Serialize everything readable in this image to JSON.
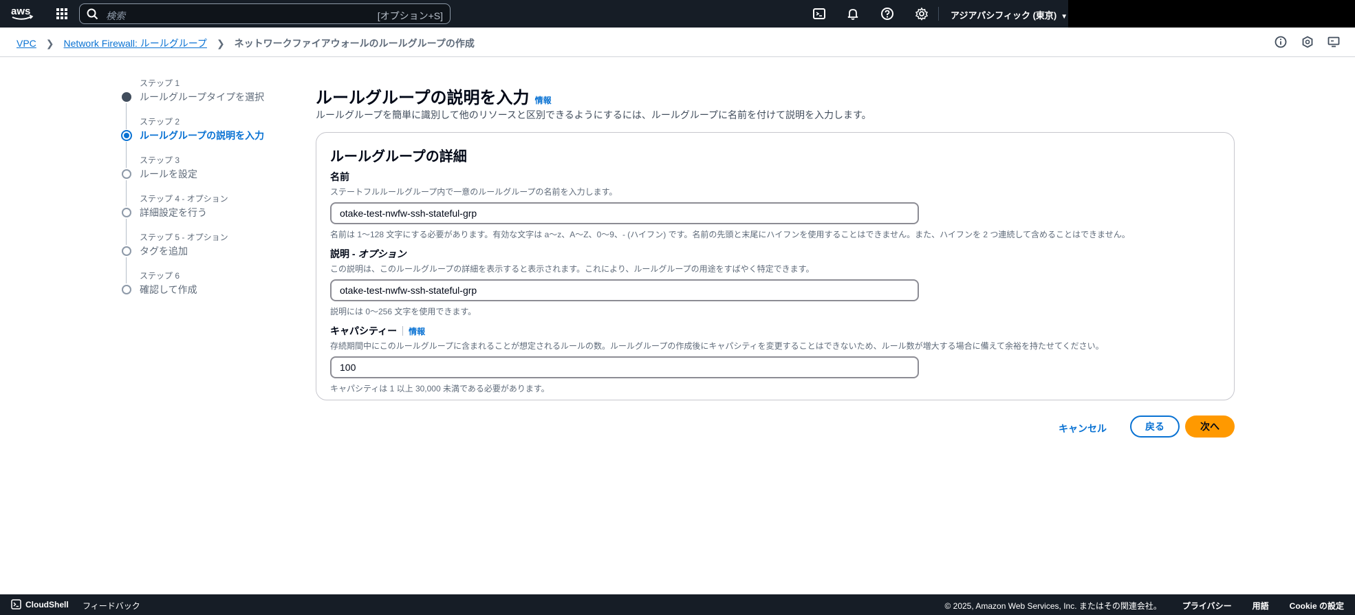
{
  "nav": {
    "search_placeholder": "検索",
    "search_shortcut": "[オプション+S]",
    "region": "アジアパシフィック (東京)"
  },
  "breadcrumb": {
    "items": [
      "VPC",
      "Network Firewall: ルールグループ"
    ],
    "current": "ネットワークファイアウォールのルールグループの作成"
  },
  "steps": [
    {
      "num": "ステップ 1",
      "title": "ルールグループタイプを選択"
    },
    {
      "num": "ステップ 2",
      "title": "ルールグループの説明を入力"
    },
    {
      "num": "ステップ 3",
      "title": "ルールを設定"
    },
    {
      "num": "ステップ 4 - オプション",
      "title": "詳細設定を行う"
    },
    {
      "num": "ステップ 5 - オプション",
      "title": "タグを追加"
    },
    {
      "num": "ステップ 6",
      "title": "確認して作成"
    }
  ],
  "main": {
    "title": "ルールグループの説明を入力",
    "info": "情報",
    "description": "ルールグループを簡単に識別して他のリソースと区別できるようにするには、ルールグループに名前を付けて説明を入力します。"
  },
  "panel": {
    "title": "ルールグループの詳細",
    "name": {
      "label": "名前",
      "desc": "ステートフルルールグループ内で一意のルールグループの名前を入力します。",
      "value": "otake-test-nwfw-ssh-stateful-grp",
      "constraint": "名前は 1～128 文字にする必要があります。有効な文字は a～z、A～Z、0～9、- (ハイフン) です。名前の先頭と末尾にハイフンを使用することはできません。また、ハイフンを 2 つ連続して含めることはできません。"
    },
    "description": {
      "label": "説明 - ",
      "label_optional": "オプション",
      "desc": "この説明は、このルールグループの詳細を表示すると表示されます。これにより、ルールグループの用途をすばやく特定できます。",
      "value": "otake-test-nwfw-ssh-stateful-grp",
      "constraint": "説明には 0～256 文字を使用できます。"
    },
    "capacity": {
      "label": "キャパシティー",
      "info": "情報",
      "desc": "存続期間中にこのルールグループに含まれることが想定されるルールの数。ルールグループの作成後にキャパシティを変更することはできないため、ルール数が増大する場合に備えて余裕を持たせてください。",
      "value": "100",
      "constraint": "キャパシティは 1 以上 30,000 未満である必要があります。"
    }
  },
  "actions": {
    "cancel": "キャンセル",
    "back": "戻る",
    "next": "次へ"
  },
  "footer": {
    "cloudshell": "CloudShell",
    "feedback": "フィードバック",
    "copyright": "© 2025, Amazon Web Services, Inc. またはその関連会社。",
    "privacy": "プライバシー",
    "terms": "用語",
    "cookie": "Cookie の設定"
  }
}
